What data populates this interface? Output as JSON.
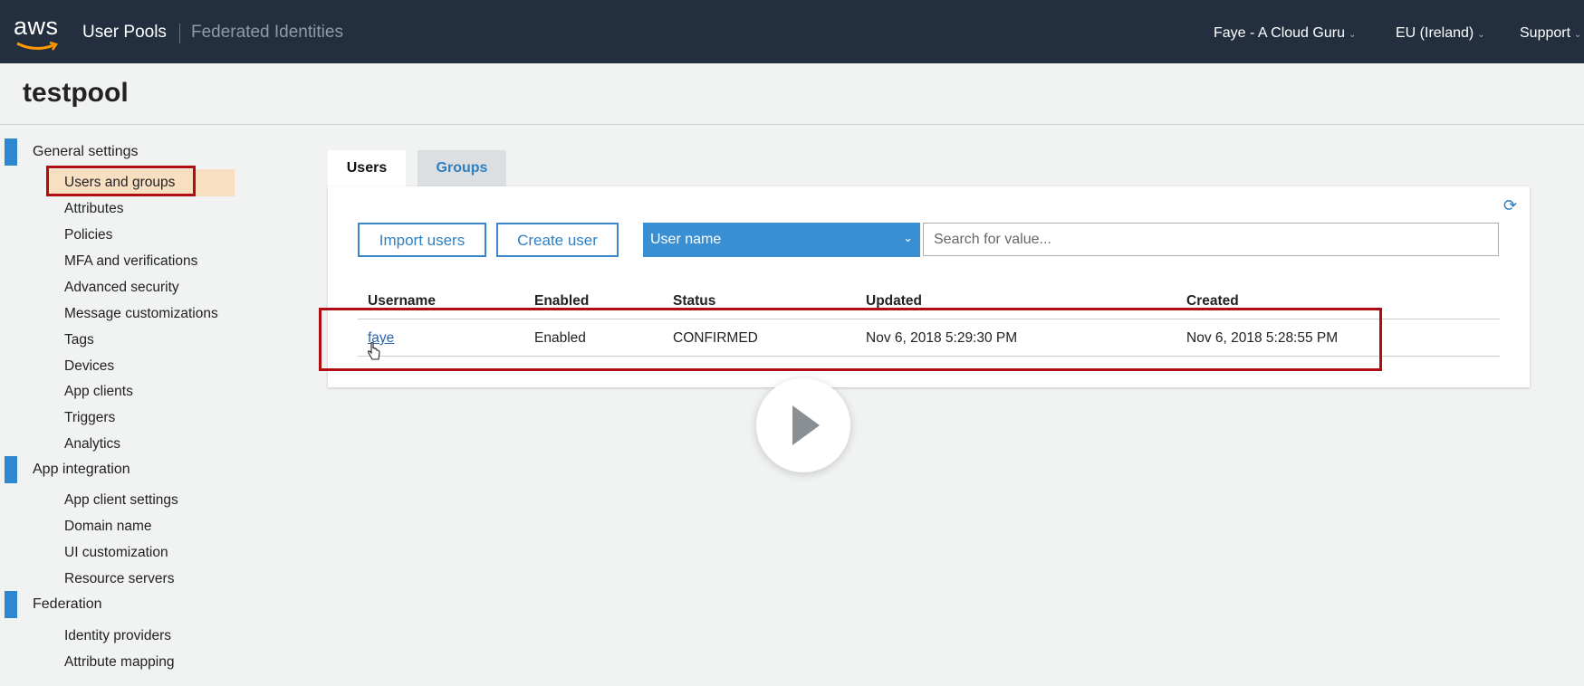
{
  "topbar": {
    "logo_text": "aws",
    "user_pools": "User Pools",
    "federated_identities": "Federated Identities",
    "account": "Faye - A Cloud Guru",
    "region": "EU (Ireland)",
    "support": "Support"
  },
  "page": {
    "title": "testpool"
  },
  "sidebar": {
    "general": {
      "label": "General settings",
      "items": [
        "Users and groups",
        "Attributes",
        "Policies",
        "MFA and verifications",
        "Advanced security",
        "Message customizations",
        "Tags",
        "Devices",
        "App clients",
        "Triggers",
        "Analytics"
      ]
    },
    "app_integration": {
      "label": "App integration",
      "items": [
        "App client settings",
        "Domain name",
        "UI customization",
        "Resource servers"
      ]
    },
    "federation": {
      "label": "Federation",
      "items": [
        "Identity providers",
        "Attribute mapping"
      ]
    },
    "active_item": "Users and groups"
  },
  "tabs": {
    "users": "Users",
    "groups": "Groups"
  },
  "toolbar": {
    "import_label": "Import users",
    "create_label": "Create user",
    "filter_selected": "User name",
    "search_placeholder": "Search for value..."
  },
  "table": {
    "headers": [
      "Username",
      "Enabled",
      "Status",
      "Updated",
      "Created"
    ],
    "rows": [
      [
        "faye",
        "Enabled",
        "CONFIRMED",
        "Nov 6, 2018 5:29:30 PM",
        "Nov 6, 2018 5:28:55 PM"
      ]
    ]
  },
  "icons": {
    "refresh": "refresh-icon",
    "play": "play-icon",
    "cursor": "hand-cursor-icon",
    "dropdown": "chevron-down-icon"
  },
  "colors": {
    "topbar": "#232f3e",
    "accent_blue": "#3a8fd3",
    "highlight_red": "#b00d12",
    "active_bg": "#f8dfc2"
  }
}
